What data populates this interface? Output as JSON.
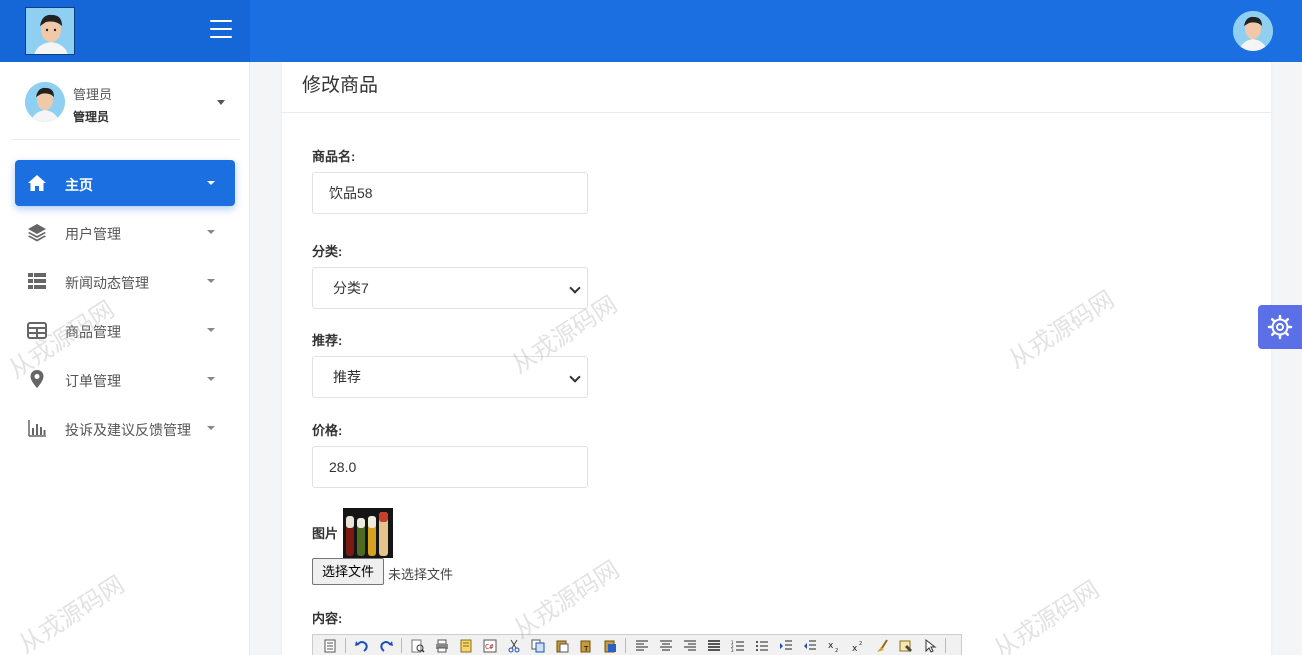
{
  "header": {
    "logo_icon": "user-photo-logo",
    "menu_icon": "hamburger-icon",
    "avatar_icon": "user-avatar-photo",
    "bg_color": "#1b6fe0"
  },
  "sidebar": {
    "user": {
      "name": "管理员",
      "role": "管理员"
    },
    "items": [
      {
        "label": "主页",
        "icon": "home-icon",
        "active": true
      },
      {
        "label": "用户管理",
        "icon": "layers-icon"
      },
      {
        "label": "新闻动态管理",
        "icon": "list-icon"
      },
      {
        "label": "商品管理",
        "icon": "table-icon"
      },
      {
        "label": "订单管理",
        "icon": "map-pin-icon"
      },
      {
        "label": "投诉及建议反馈管理",
        "icon": "bar-chart-icon"
      }
    ]
  },
  "main": {
    "title": "修改商品",
    "form": {
      "name_label": "商品名:",
      "name_value": "饮品58",
      "category_label": "分类:",
      "category_value": "分类7",
      "recommend_label": "推荐:",
      "recommend_value": "推荐",
      "price_label": "价格:",
      "price_value": "28.0",
      "image_label": "图片",
      "file_button": "选择文件",
      "file_status": "未选择文件",
      "content_label": "内容:"
    }
  },
  "watermark": "从戎源码网",
  "colors": {
    "accent": "#1b6fe0",
    "settings": "#5b6fe6"
  }
}
